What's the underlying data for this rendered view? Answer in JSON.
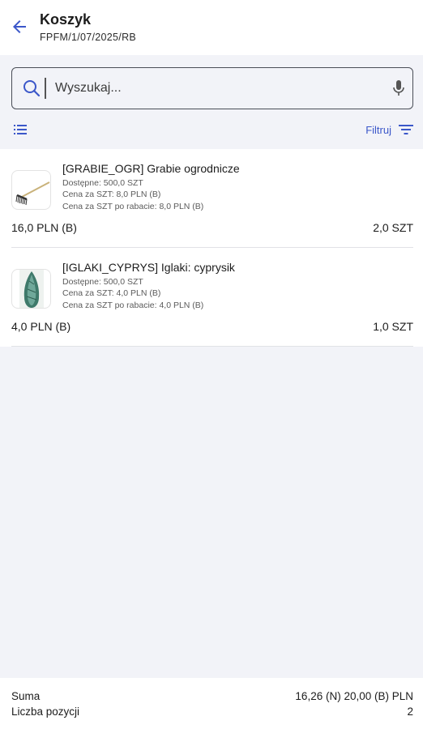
{
  "header": {
    "title": "Koszyk",
    "subtitle": "FPFM/1/07/2025/RB",
    "back_icon": "arrow-left-icon"
  },
  "search": {
    "placeholder": "Wyszukaj...",
    "search_icon": "search-icon",
    "mic_icon": "mic-icon"
  },
  "toolbar": {
    "list_icon": "list-view-icon",
    "filter_label": "Filtruj",
    "filter_icon": "filter-icon"
  },
  "items": [
    {
      "name": "[GRABIE_OGR] Grabie ogrodnicze",
      "available": "Dostępne: 500,0 SZT",
      "unit_price": "Cena za SZT: 8,0 PLN (B)",
      "discount_price": "Cena za SZT po rabacie: 8,0 PLN (B)",
      "total": "16,0 PLN (B)",
      "quantity": "2,0 SZT",
      "image": "rake-image"
    },
    {
      "name": "[IGLAKI_CYPRYS] Iglaki: cyprysik",
      "available": "Dostępne: 500,0 SZT",
      "unit_price": "Cena za SZT: 4,0 PLN (B)",
      "discount_price": "Cena za SZT po rabacie: 4,0 PLN (B)",
      "total": "4,0 PLN (B)",
      "quantity": "1,0 SZT",
      "image": "cypress-image"
    }
  ],
  "summary": {
    "sum_label": "Suma",
    "sum_value": "16,26 (N) 20,00 (B) PLN",
    "count_label": "Liczba pozycji",
    "count_value": "2"
  },
  "colors": {
    "accent": "#3b57c9",
    "background": "#f2f3f8",
    "card": "#ffffff"
  }
}
